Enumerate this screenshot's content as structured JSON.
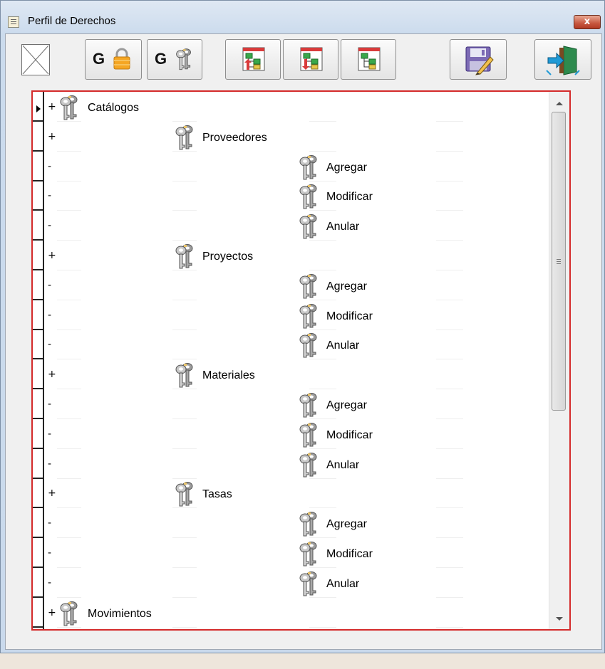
{
  "window": {
    "title": "Perfil de Derechos",
    "close_label": "x"
  },
  "toolbar": {
    "buttons": [
      {
        "name": "group-lock-button",
        "label": "G",
        "icon": "padlock-icon"
      },
      {
        "name": "group-keys-button",
        "label": "G",
        "icon": "keys-icon"
      },
      {
        "name": "tree-up-button",
        "icon": "tree-up-icon"
      },
      {
        "name": "tree-down-button",
        "icon": "tree-down-icon"
      },
      {
        "name": "tree-button",
        "icon": "tree-icon"
      },
      {
        "name": "save-button",
        "icon": "save-disk-icon"
      },
      {
        "name": "exit-button",
        "icon": "exit-door-icon"
      }
    ]
  },
  "tree": {
    "rows": [
      {
        "sign": "+",
        "label": "Catálogos",
        "level": 0,
        "current": true
      },
      {
        "sign": "+",
        "label": "Proveedores",
        "level": 1
      },
      {
        "sign": "-",
        "label": "Agregar",
        "level": 2
      },
      {
        "sign": "-",
        "label": "Modificar",
        "level": 2
      },
      {
        "sign": "-",
        "label": "Anular",
        "level": 2
      },
      {
        "sign": "+",
        "label": "Proyectos",
        "level": 1
      },
      {
        "sign": "-",
        "label": "Agregar",
        "level": 2
      },
      {
        "sign": "-",
        "label": "Modificar",
        "level": 2
      },
      {
        "sign": "-",
        "label": "Anular",
        "level": 2
      },
      {
        "sign": "+",
        "label": "Materiales",
        "level": 1
      },
      {
        "sign": "-",
        "label": "Agregar",
        "level": 2
      },
      {
        "sign": "-",
        "label": "Modificar",
        "level": 2
      },
      {
        "sign": "-",
        "label": "Anular",
        "level": 2
      },
      {
        "sign": "+",
        "label": "Tasas",
        "level": 1
      },
      {
        "sign": "-",
        "label": "Agregar",
        "level": 2
      },
      {
        "sign": "-",
        "label": "Modificar",
        "level": 2
      },
      {
        "sign": "-",
        "label": "Anular",
        "level": 2
      },
      {
        "sign": "+",
        "label": "Movimientos",
        "level": 0
      }
    ]
  },
  "colors": {
    "pane_border": "#d42a2a",
    "close_button": "#c7573f"
  }
}
